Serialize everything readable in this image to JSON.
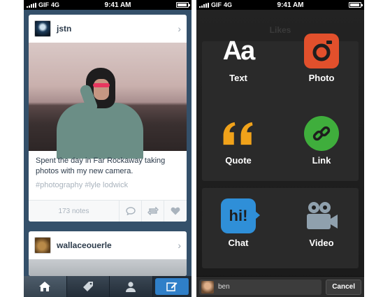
{
  "left_phone": {
    "status": {
      "carrier": "GIF",
      "network": "4G",
      "time": "9:41 AM"
    },
    "post1": {
      "username": "jstn",
      "caption": "Spent the day in Far Rockaway taking photos with my new camera.",
      "tags": "#photography  #lyle lodwick",
      "notes": "173 notes"
    },
    "post2": {
      "username": "wallaceouerle"
    },
    "tabbar": {
      "icons": [
        "home-icon",
        "tag-icon",
        "account-icon",
        "compose-icon"
      ]
    },
    "colors": {
      "background": "#34506a",
      "compose": "#2f7fc8"
    }
  },
  "right_phone": {
    "status": {
      "carrier": "GIF",
      "network": "4G",
      "time": "9:41 AM"
    },
    "background_title": "Likes",
    "types": [
      {
        "label": "Text",
        "icon": "text-icon"
      },
      {
        "label": "Photo",
        "icon": "camera-icon"
      },
      {
        "label": "Quote",
        "icon": "quote-icon"
      },
      {
        "label": "Link",
        "icon": "link-icon"
      },
      {
        "label": "Chat",
        "icon": "chat-icon"
      },
      {
        "label": "Video",
        "icon": "video-camera-icon"
      }
    ],
    "blog_name": "ben",
    "cancel_label": "Cancel",
    "colors": {
      "photo": "#e2502c",
      "quote": "#f0a21a",
      "link": "#3fae3c",
      "chat": "#2f8fd8",
      "video": "#8fa0ad"
    }
  }
}
